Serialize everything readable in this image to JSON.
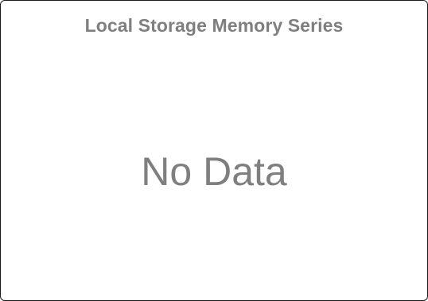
{
  "panel": {
    "title": "Local Storage Memory Series",
    "empty_message": "No Data"
  },
  "colors": {
    "text": "#7f7f7f",
    "border": "#1a1a1a",
    "background": "#ffffff"
  }
}
